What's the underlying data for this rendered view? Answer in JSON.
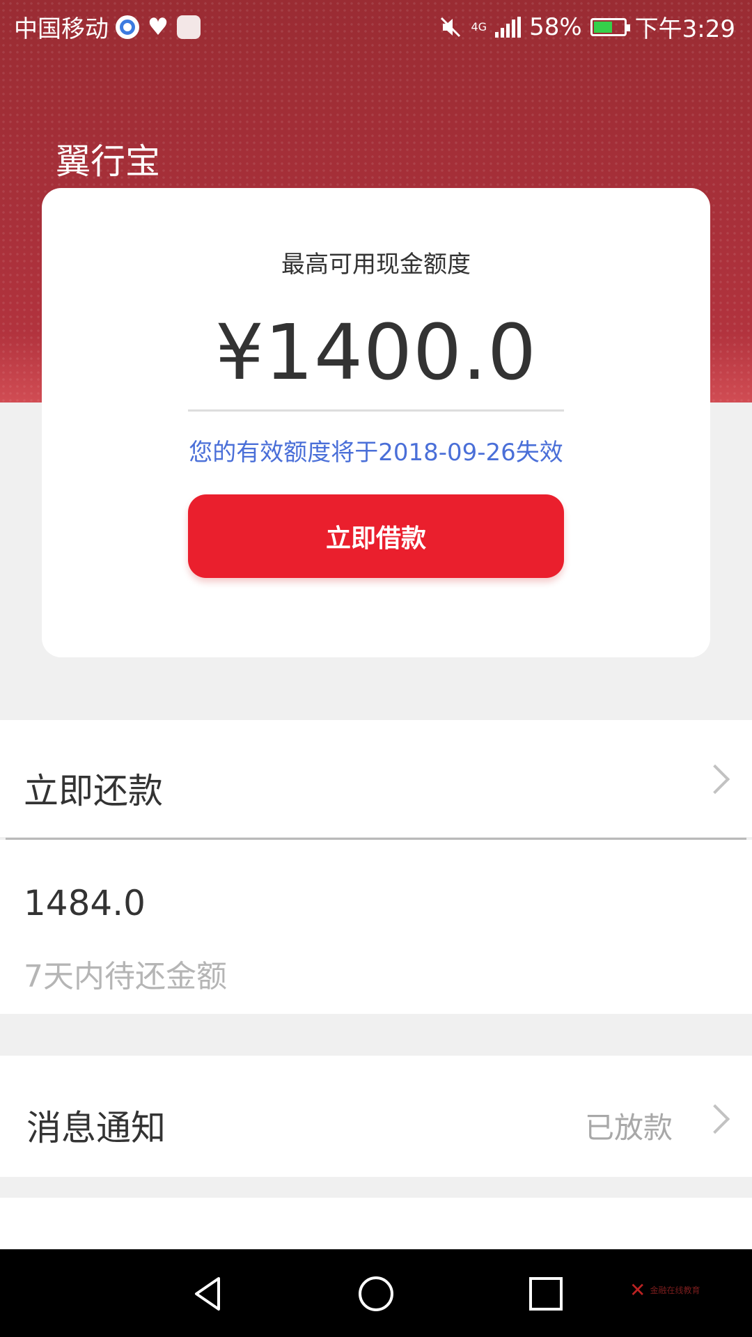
{
  "status_bar": {
    "carrier": "中国移动",
    "network": "4G",
    "battery": "58%",
    "time": "下午3:29",
    "icons": [
      "browser-icon",
      "health-icon",
      "map-icon",
      "mute-icon",
      "signal-icon",
      "battery-icon"
    ],
    "battery_color": "#35d04a"
  },
  "app": {
    "title": "翼行宝"
  },
  "card": {
    "label": "最高可用现金额度",
    "amount": "¥1400.0",
    "expiry": "您的有效额度将于2018-09-26失效",
    "borrow_button": "立即借款"
  },
  "repay": {
    "title": "立即还款",
    "amount": "1484.0",
    "amount_label": "7天内待还金额"
  },
  "notifications": {
    "title": "消息通知",
    "status": "已放款"
  },
  "watermark": {
    "text": "金融在线教育"
  },
  "colors": {
    "header": "#a8303a",
    "button": "#ea1f2d",
    "link": "#4a6fd8"
  }
}
